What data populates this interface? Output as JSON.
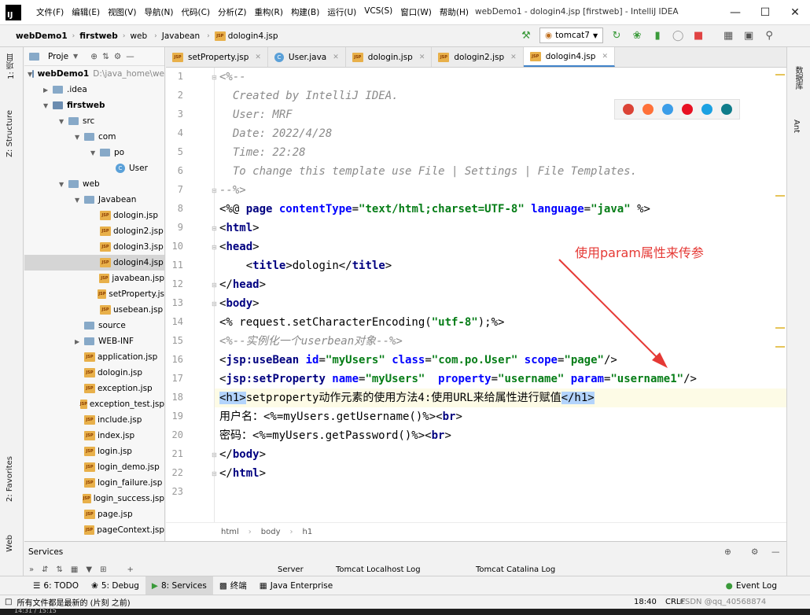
{
  "app": {
    "logo": "IJ",
    "window_title": "webDemo1 - dologin4.jsp [firstweb] - IntelliJ IDEA",
    "menu": [
      "文件(F)",
      "编辑(E)",
      "视图(V)",
      "导航(N)",
      "代码(C)",
      "分析(Z)",
      "重构(R)",
      "构建(B)",
      "运行(U)",
      "VCS(S)",
      "窗口(W)",
      "帮助(H)"
    ]
  },
  "breadcrumb": [
    "webDemo1",
    "firstweb",
    "web",
    "Javabean",
    "dologin4.jsp"
  ],
  "run_config": {
    "name": "tomcat7"
  },
  "side_tabs": {
    "project": "1: 项目",
    "structure": "Z: Structure",
    "favorites": "2: Favorites",
    "web": "Web",
    "database": "数据库",
    "ant": "Ant"
  },
  "project_panel": {
    "title": "Proje",
    "tree": [
      {
        "label": "webDemo1",
        "extra": "D:\\java_home\\we",
        "indent": 0,
        "kind": "module",
        "open": true,
        "bold": true
      },
      {
        "label": ".idea",
        "indent": 1,
        "kind": "folder",
        "open": false
      },
      {
        "label": "firstweb",
        "indent": 1,
        "kind": "module",
        "open": true,
        "bold": true
      },
      {
        "label": "src",
        "indent": 2,
        "kind": "folder",
        "open": true
      },
      {
        "label": "com",
        "indent": 3,
        "kind": "folder",
        "open": true
      },
      {
        "label": "po",
        "indent": 4,
        "kind": "folder",
        "open": true
      },
      {
        "label": "User",
        "indent": 5,
        "kind": "class",
        "open": false
      },
      {
        "label": "web",
        "indent": 2,
        "kind": "folder",
        "open": true
      },
      {
        "label": "Javabean",
        "indent": 3,
        "kind": "folder",
        "open": true
      },
      {
        "label": "dologin.jsp",
        "indent": 4,
        "kind": "jsp"
      },
      {
        "label": "dologin2.jsp",
        "indent": 4,
        "kind": "jsp"
      },
      {
        "label": "dologin3.jsp",
        "indent": 4,
        "kind": "jsp"
      },
      {
        "label": "dologin4.jsp",
        "indent": 4,
        "kind": "jsp",
        "selected": true
      },
      {
        "label": "javabean.jsp",
        "indent": 4,
        "kind": "jsp"
      },
      {
        "label": "setProperty.js",
        "indent": 4,
        "kind": "jsp"
      },
      {
        "label": "usebean.jsp",
        "indent": 4,
        "kind": "jsp"
      },
      {
        "label": "source",
        "indent": 3,
        "kind": "folder",
        "leaf": true
      },
      {
        "label": "WEB-INF",
        "indent": 3,
        "kind": "folder",
        "open": false
      },
      {
        "label": "application.jsp",
        "indent": 3,
        "kind": "jsp"
      },
      {
        "label": "dologin.jsp",
        "indent": 3,
        "kind": "jsp"
      },
      {
        "label": "exception.jsp",
        "indent": 3,
        "kind": "jsp"
      },
      {
        "label": "exception_test.jsp",
        "indent": 3,
        "kind": "jsp"
      },
      {
        "label": "include.jsp",
        "indent": 3,
        "kind": "jsp"
      },
      {
        "label": "index.jsp",
        "indent": 3,
        "kind": "jsp"
      },
      {
        "label": "login.jsp",
        "indent": 3,
        "kind": "jsp"
      },
      {
        "label": "login_demo.jsp",
        "indent": 3,
        "kind": "jsp"
      },
      {
        "label": "login_failure.jsp",
        "indent": 3,
        "kind": "jsp"
      },
      {
        "label": "login_success.jsp",
        "indent": 3,
        "kind": "jsp"
      },
      {
        "label": "page.jsp",
        "indent": 3,
        "kind": "jsp"
      },
      {
        "label": "pageContext.jsp",
        "indent": 3,
        "kind": "jsp"
      }
    ]
  },
  "editor": {
    "tabs": [
      {
        "label": "setProperty.jsp",
        "kind": "jsp"
      },
      {
        "label": "User.java",
        "kind": "java"
      },
      {
        "label": "dologin.jsp",
        "kind": "jsp"
      },
      {
        "label": "dologin2.jsp",
        "kind": "jsp"
      },
      {
        "label": "dologin4.jsp",
        "kind": "jsp",
        "active": true
      }
    ],
    "current_line": 18,
    "lines": [
      [
        [
          "cmt",
          "<%--"
        ]
      ],
      [
        [
          "cmt",
          "  Created by IntelliJ IDEA."
        ]
      ],
      [
        [
          "cmt",
          "  User: MRF"
        ]
      ],
      [
        [
          "cmt",
          "  Date: 2022/4/28"
        ]
      ],
      [
        [
          "cmt",
          "  Time: 22:28"
        ]
      ],
      [
        [
          "cmt",
          "  To change this template use File | Settings | File Templates."
        ]
      ],
      [
        [
          "cmt",
          "--%>"
        ]
      ],
      [
        [
          "txt",
          "<%@ "
        ],
        [
          "tg",
          "page "
        ],
        [
          "at",
          "contentType"
        ],
        [
          "txt",
          "="
        ],
        [
          "vl",
          "\"text/html;charset=UTF-8\""
        ],
        [
          "txt",
          " "
        ],
        [
          "at",
          "language"
        ],
        [
          "txt",
          "="
        ],
        [
          "vl",
          "\"java\""
        ],
        [
          "txt",
          " %>"
        ]
      ],
      [
        [
          "txt",
          "<"
        ],
        [
          "tg",
          "html"
        ],
        [
          "txt",
          ">"
        ]
      ],
      [
        [
          "txt",
          "<"
        ],
        [
          "tg",
          "head"
        ],
        [
          "txt",
          ">"
        ]
      ],
      [
        [
          "txt",
          "    <"
        ],
        [
          "tg",
          "title"
        ],
        [
          "txt",
          ">dologin</"
        ],
        [
          "tg",
          "title"
        ],
        [
          "txt",
          ">"
        ]
      ],
      [
        [
          "txt",
          "</"
        ],
        [
          "tg",
          "head"
        ],
        [
          "txt",
          ">"
        ]
      ],
      [
        [
          "txt",
          "<"
        ],
        [
          "tg",
          "body"
        ],
        [
          "txt",
          ">"
        ]
      ],
      [
        [
          "txt",
          "<% request.setCharacterEncoding("
        ],
        [
          "vl",
          "\"utf-8\""
        ],
        [
          "txt",
          ");%>"
        ]
      ],
      [
        [
          "cmt",
          "<%--实例化一个userbean对象--%>"
        ]
      ],
      [
        [
          "txt",
          "<"
        ],
        [
          "tg",
          "jsp:useBean "
        ],
        [
          "at",
          "id"
        ],
        [
          "txt",
          "="
        ],
        [
          "vl",
          "\"myUsers\""
        ],
        [
          "txt",
          " "
        ],
        [
          "at",
          "class"
        ],
        [
          "txt",
          "="
        ],
        [
          "vl",
          "\"com.po.User\""
        ],
        [
          "txt",
          " "
        ],
        [
          "at",
          "scope"
        ],
        [
          "txt",
          "="
        ],
        [
          "vl",
          "\"page\""
        ],
        [
          "txt",
          "/>"
        ]
      ],
      [
        [
          "txt",
          "<"
        ],
        [
          "tg",
          "jsp:setProperty "
        ],
        [
          "at",
          "name"
        ],
        [
          "txt",
          "="
        ],
        [
          "vl",
          "\"myUsers\""
        ],
        [
          "txt",
          "  "
        ],
        [
          "at",
          "property"
        ],
        [
          "txt",
          "="
        ],
        [
          "vl",
          "\"username\""
        ],
        [
          "txt",
          " "
        ],
        [
          "at",
          "param"
        ],
        [
          "txt",
          "="
        ],
        [
          "vl",
          "\"username1\""
        ],
        [
          "txt",
          "/>"
        ]
      ],
      [
        [
          "hl",
          "<h1>"
        ],
        [
          "txt",
          "setproperty动作元素的使用方法4:使用URL来给属性进行赋值"
        ],
        [
          "hl",
          "</h1>"
        ]
      ],
      [
        [
          "txt",
          "用户名："
        ],
        [
          "txt",
          "<%=myUsers.getUsername()%>"
        ],
        [
          "txt",
          "<"
        ],
        [
          "tg",
          "br"
        ],
        [
          "txt",
          ">"
        ]
      ],
      [
        [
          "txt",
          "密码："
        ],
        [
          "txt",
          "<%=myUsers.getPassword()%>"
        ],
        [
          "txt",
          "<"
        ],
        [
          "tg",
          "br"
        ],
        [
          "txt",
          ">"
        ]
      ],
      [
        [
          "txt",
          "</"
        ],
        [
          "tg",
          "body"
        ],
        [
          "txt",
          ">"
        ]
      ],
      [
        [
          "txt",
          "</"
        ],
        [
          "tg",
          "html"
        ],
        [
          "txt",
          ">"
        ]
      ],
      []
    ],
    "breadcrumb": [
      "html",
      "body",
      "h1"
    ],
    "annotation": "使用param属性来传参"
  },
  "services": {
    "title": "Services",
    "subtabs": [
      "Server",
      "Tomcat Localhost Log",
      "Tomcat Catalina Log"
    ]
  },
  "bottom_tabs": [
    "6: TODO",
    "5: Debug",
    "8: Services",
    "终端",
    "Java Enterprise",
    "Event Log"
  ],
  "status": {
    "message": "所有文件都是最新的 (片刻 之前)",
    "caret": "18:40",
    "line_sep": "CRLF",
    "watermark": "CSDN @qq_40568874",
    "taskbar_time": "14:31 / 15:15"
  },
  "colors": {
    "accent": "#4083c9",
    "annotation": "#e53935"
  }
}
